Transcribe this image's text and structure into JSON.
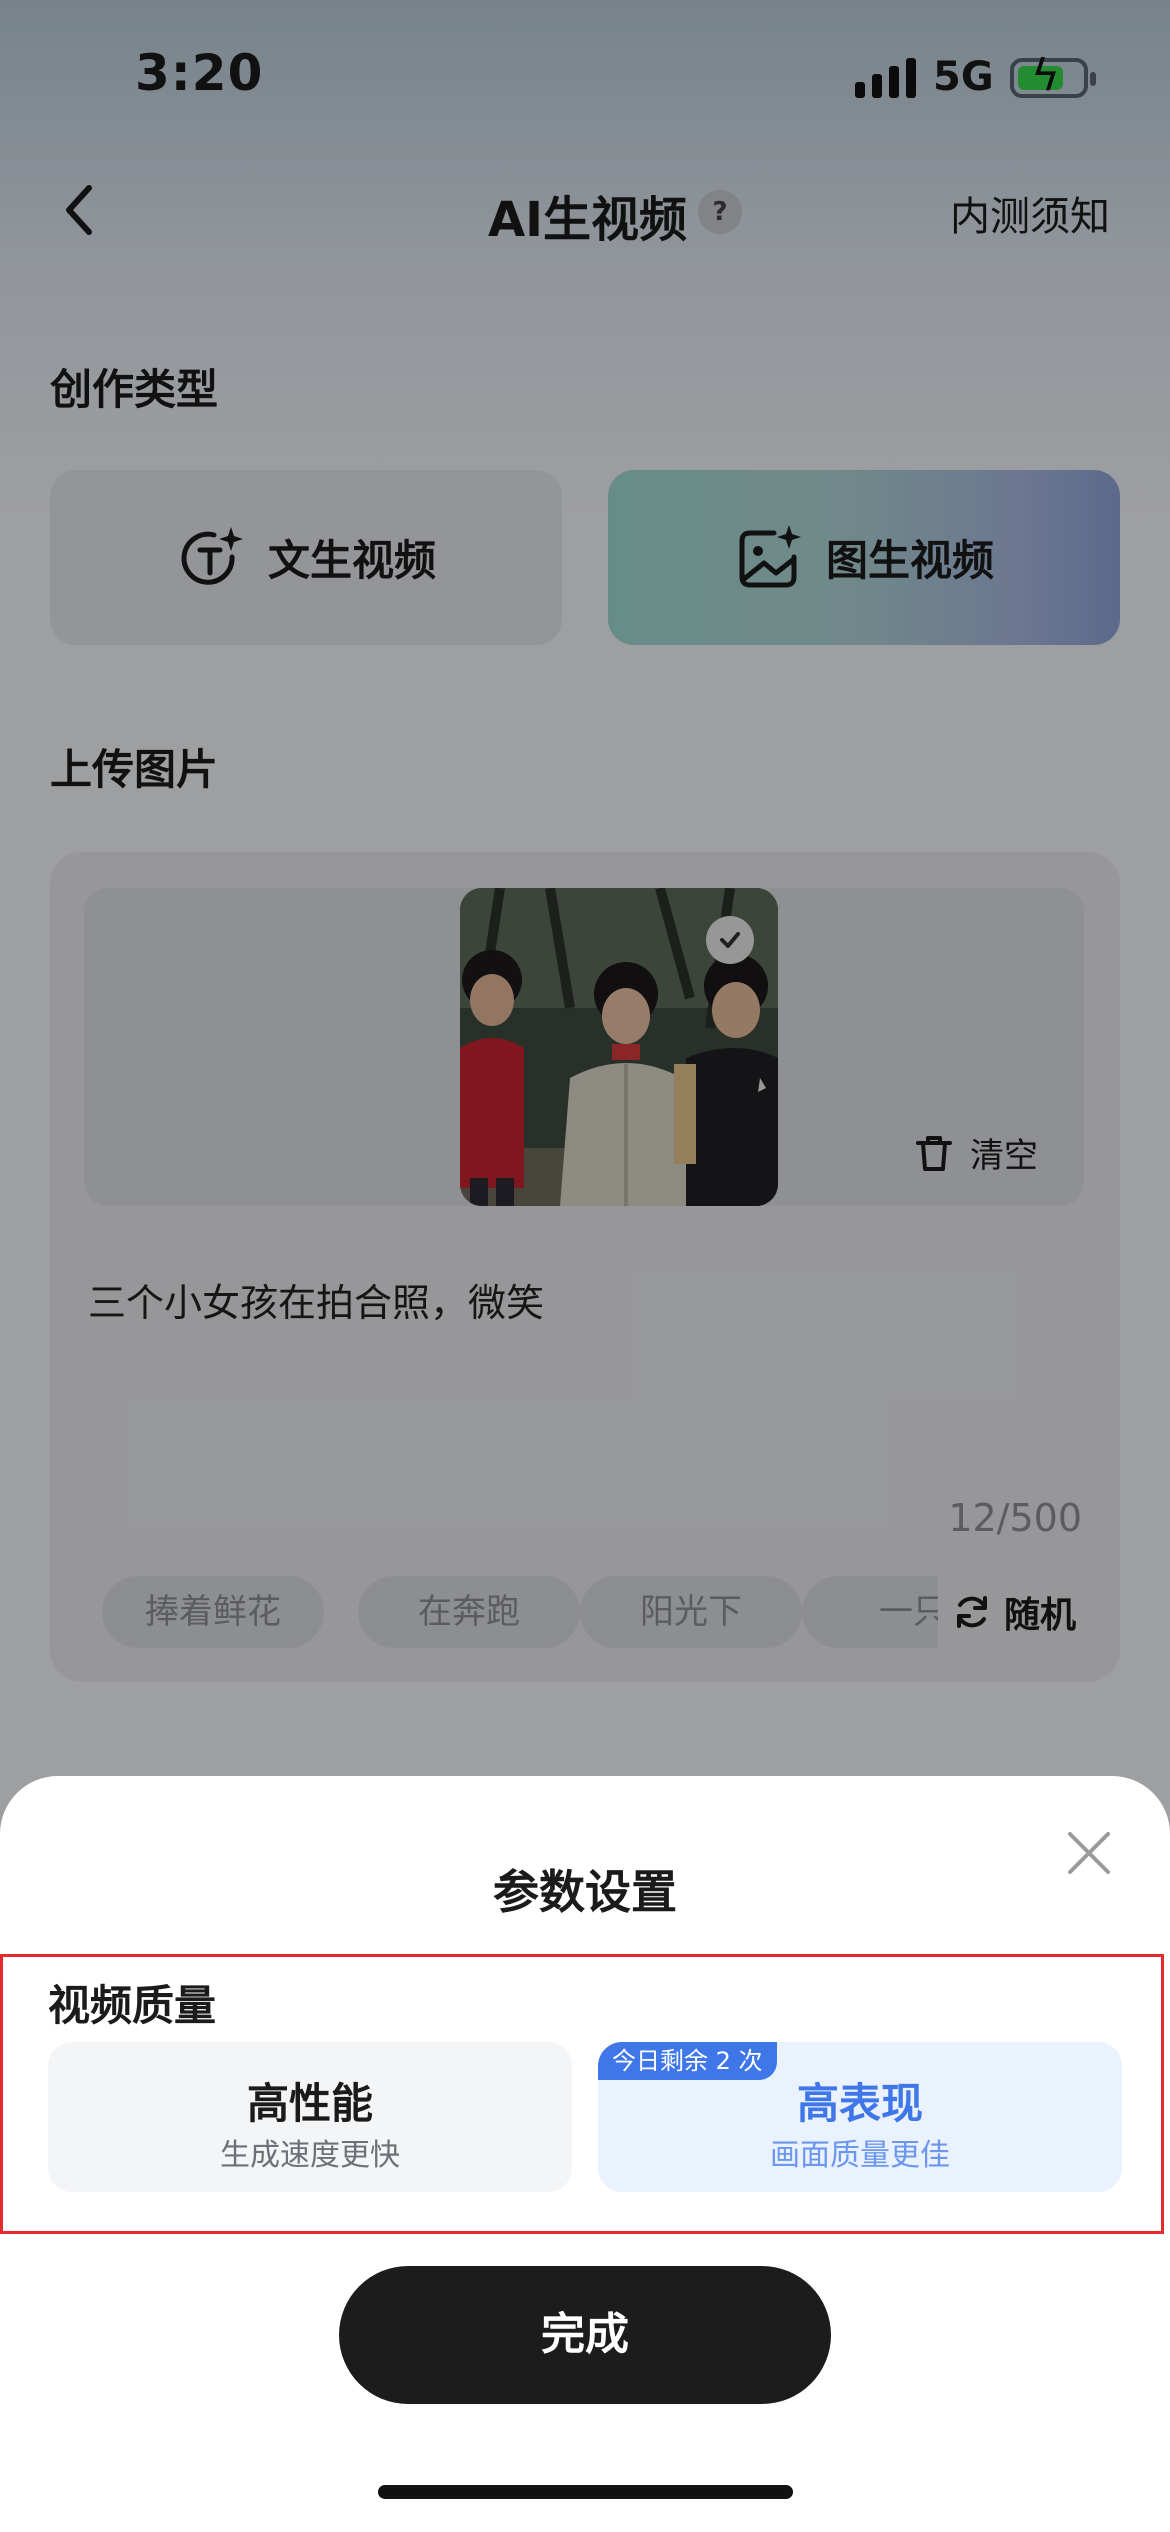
{
  "status_bar": {
    "time": "3:20",
    "network": "5G"
  },
  "nav": {
    "title": "AI生视频",
    "help": "?",
    "right_link": "内测须知"
  },
  "creation_type": {
    "label": "创作类型",
    "options": [
      {
        "label": "文生视频",
        "icon": "text-spark-icon",
        "selected": false
      },
      {
        "label": "图生视频",
        "icon": "image-spark-icon",
        "selected": true
      }
    ]
  },
  "upload": {
    "label": "上传图片",
    "clear_label": "清空",
    "prompt": "三个小女孩在拍合照，微笑",
    "char_count": "12/500",
    "chips": [
      "捧着鲜花",
      "在奔跑",
      "阳光下",
      "一只"
    ],
    "random_label": "随机"
  },
  "sheet": {
    "title": "参数设置",
    "quality_label": "视频质量",
    "options": [
      {
        "title": "高性能",
        "subtitle": "生成速度更快",
        "selected": false
      },
      {
        "title": "高表现",
        "subtitle": "画面质量更佳",
        "selected": true,
        "badge": "今日剩余 2 次"
      }
    ],
    "done_label": "完成"
  },
  "colors": {
    "accent": "#3f77e8",
    "highlight_border": "#e52b2b",
    "primary_button": "#1c1c1c"
  }
}
